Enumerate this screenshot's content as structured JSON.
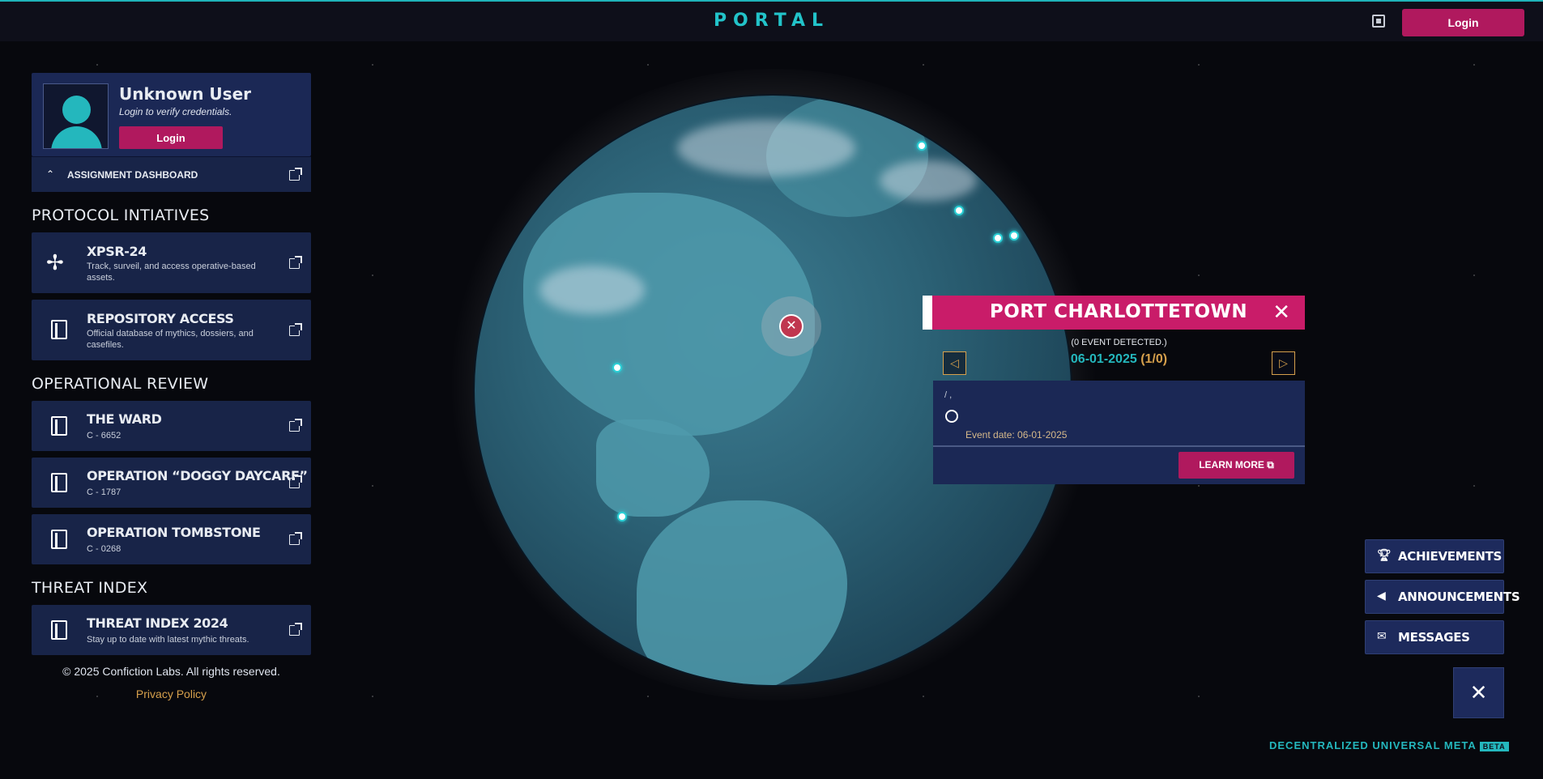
{
  "header": {
    "brand": "PORTAL",
    "login_label": "Login",
    "help_icon": "manual-icon"
  },
  "profile": {
    "username": "Unknown User",
    "message": "Login to verify credentials.",
    "login_label": "Login",
    "dashboard_label": "ASSIGNMENT DASHBOARD"
  },
  "sections": {
    "protocol": {
      "title": "PROTOCOL INTIATIVES",
      "items": [
        {
          "title": "XPSR-24",
          "sub": "Track, surveil, and access operative-based assets.",
          "icon": "xpsr-emblem-icon"
        },
        {
          "title": "REPOSITORY ACCESS",
          "sub": "Official database of mythics, dossiers, and casefiles.",
          "icon": "book-icon"
        }
      ]
    },
    "operational": {
      "title": "OPERATIONAL REVIEW",
      "items": [
        {
          "title": "THE WARD",
          "sub": "C - 6652",
          "icon": "book-icon"
        },
        {
          "title": "OPERATION “DOGGY DAYCARE”",
          "sub": "C - 1787",
          "icon": "book-icon"
        },
        {
          "title": "OPERATION TOMBSTONE",
          "sub": "C - 0268",
          "icon": "book-icon"
        }
      ]
    },
    "threat": {
      "title": "THREAT INDEX",
      "items": [
        {
          "title": "THREAT INDEX 2024",
          "sub": "Stay up to date with latest mythic threats.",
          "icon": "book-icon"
        }
      ]
    }
  },
  "footer": {
    "copyright": "© 2025 Confiction Labs. All rights reserved.",
    "privacy": "Privacy Policy"
  },
  "popup": {
    "title": "PORT CHARLOTTETOWN",
    "detected": "(0 EVENT DETECTED.)",
    "date": "06-01-2025",
    "count": "(1/0)",
    "slash": "/ ,",
    "event_date": "Event date: 06-01-2025",
    "learn_more": "LEARN MORE"
  },
  "right_panel": {
    "achievements": "ACHIEVEMENTS",
    "announcements": "ANNOUNCEMENTS",
    "messages": "MESSAGES"
  },
  "bottom_brand": {
    "text": "DECENTRALIZED UNIVERSAL META",
    "badge": "BETA"
  },
  "colors": {
    "accent_teal": "#22c3c9",
    "accent_magenta": "#b0195e",
    "panel_navy": "#182448",
    "gold": "#d6a04c"
  }
}
